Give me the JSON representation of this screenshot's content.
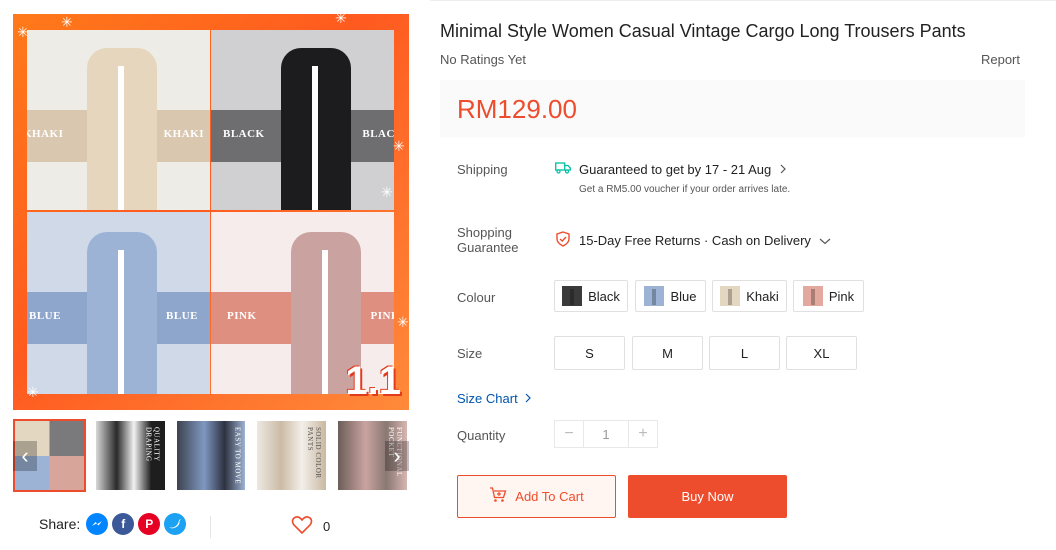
{
  "product": {
    "title": "Minimal Style Women Casual Vintage Cargo Long Trousers Pants",
    "rating_text": "No Ratings Yet",
    "report_label": "Report",
    "price": "RM129.00"
  },
  "gallery": {
    "promo_badge": "1.1",
    "panels": [
      {
        "left_label": "KHAKI",
        "right_label": "KHAKI"
      },
      {
        "left_label": "BLACK",
        "right_label": "BLACK"
      },
      {
        "left_label": "BLUE",
        "right_label": "BLUE"
      },
      {
        "left_label": "PINK",
        "right_label": "PINK"
      }
    ],
    "thumbnails": [
      {
        "caption": ""
      },
      {
        "caption": "QUALITY DRAPING"
      },
      {
        "caption": "EASY TO MOVE"
      },
      {
        "caption": "SOLID COLOR PANTS"
      },
      {
        "caption": "FUNCTIONAL POCKET"
      }
    ],
    "prev_arrow": "‹",
    "next_arrow": "›"
  },
  "shipping": {
    "label": "Shipping",
    "main": "Guaranteed to get by 17 - 21 Aug",
    "sub": "Get a RM5.00 voucher if your order arrives late."
  },
  "guarantee": {
    "label_line1": "Shopping",
    "label_line2": "Guarantee",
    "text": "15-Day Free Returns · Cash on Delivery"
  },
  "colour": {
    "label": "Colour",
    "options": [
      "Black",
      "Blue",
      "Khaki",
      "Pink"
    ]
  },
  "size": {
    "label": "Size",
    "options": [
      "S",
      "M",
      "L",
      "XL"
    ]
  },
  "size_chart": {
    "label": "Size Chart"
  },
  "quantity": {
    "label": "Quantity",
    "minus": "−",
    "value": "1",
    "plus": "+"
  },
  "actions": {
    "add_to_cart": "Add To Cart",
    "buy_now": "Buy Now"
  },
  "share": {
    "label": "Share:",
    "like_count": "0"
  },
  "colors": {
    "accent": "#ee4d2d",
    "link": "#0055aa"
  }
}
